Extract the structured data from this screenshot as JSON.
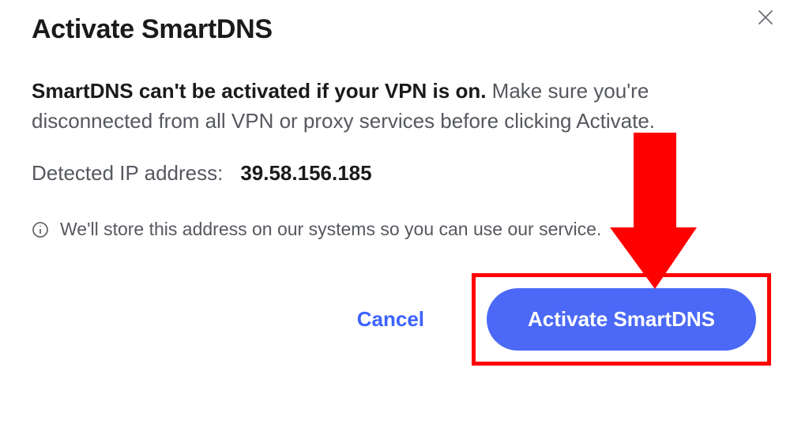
{
  "dialog": {
    "title": "Activate SmartDNS",
    "body_emphasis": "SmartDNS can't be activated if your VPN is on.",
    "body_rest": " Make sure you're disconnected from all VPN or proxy services before clicking Activate.",
    "ip_label": "Detected IP address:",
    "ip_value": "39.58.156.185",
    "info_text": "We'll store this address on our systems so you can use our service.",
    "cancel_label": "Cancel",
    "activate_label": "Activate SmartDNS"
  }
}
